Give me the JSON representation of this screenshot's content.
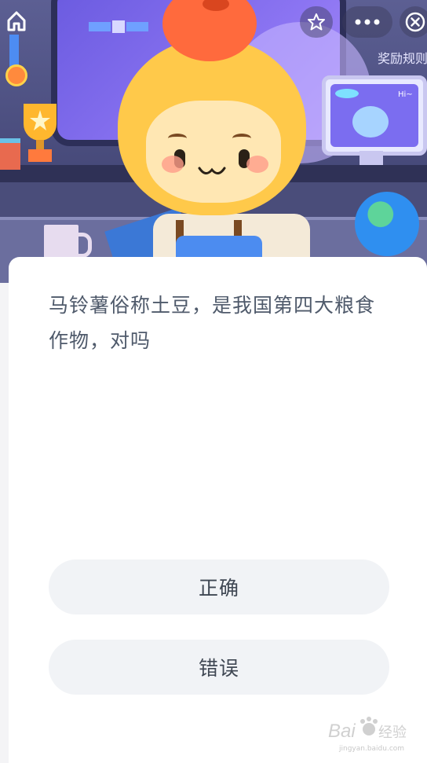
{
  "header": {
    "reward_label": "奖励规则"
  },
  "question": {
    "text": "马铃薯俗称土豆，是我国第四大粮食作物，对吗"
  },
  "options": [
    {
      "label": "正确"
    },
    {
      "label": "错误"
    }
  ],
  "monitor": {
    "greeting": "Hi~"
  },
  "watermark": {
    "brand": "Bai",
    "brand_cn": "经验",
    "url": "jingyan.baidu.com"
  },
  "colors": {
    "card_bg": "#ffffff",
    "option_bg": "#f1f3f6",
    "question_text": "#4f5a6b",
    "mascot_yellow": "#ffc94a",
    "tomato": "#ff6a3d"
  }
}
